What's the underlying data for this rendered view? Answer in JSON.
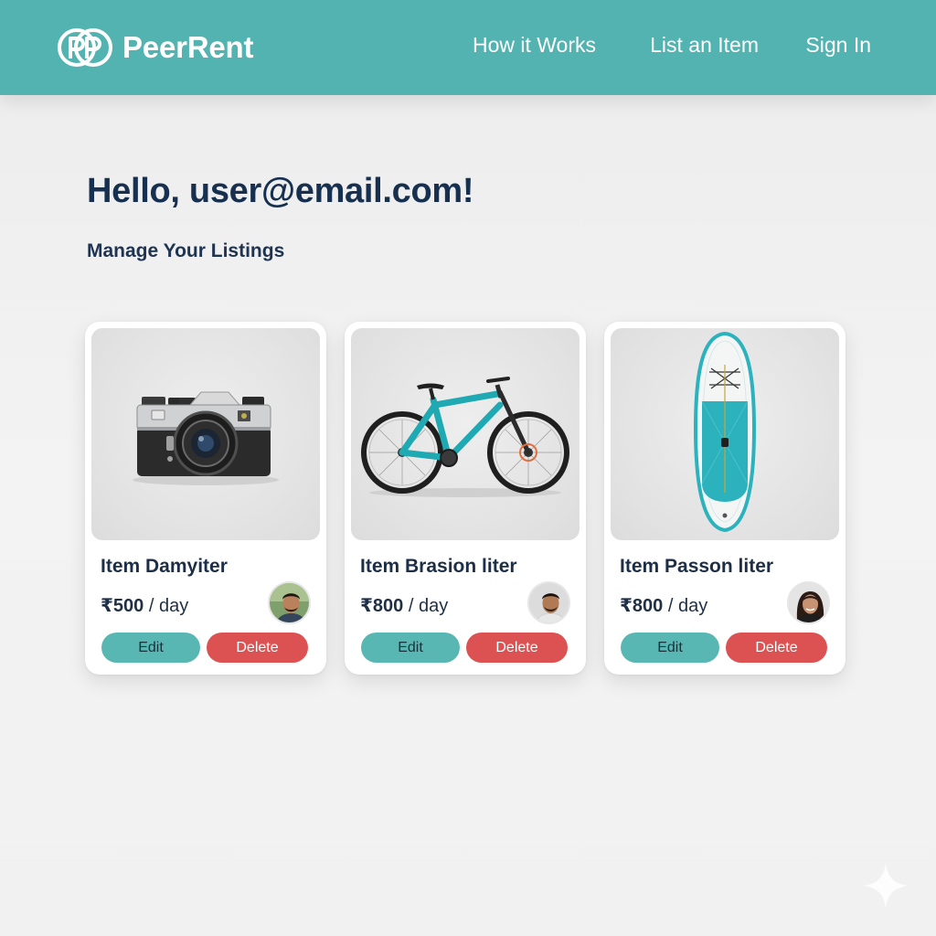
{
  "header": {
    "brand_name": "PeerRent",
    "logo_icon": "pp-monogram-icon",
    "nav": [
      "How it Works",
      "List an Item",
      "Sign In"
    ]
  },
  "main": {
    "greeting": "Hello, user@email.com!",
    "subheading": "Manage Your Listings"
  },
  "listings": [
    {
      "title": "Item Damyiter",
      "price": "₹500",
      "unit": "/ day",
      "image": "film-camera",
      "edit": "Edit",
      "delete": "Delete"
    },
    {
      "title": "Item Brasion liter",
      "price": "₹800",
      "unit": "/ day",
      "image": "teal-mountain-bike",
      "edit": "Edit",
      "delete": "Delete"
    },
    {
      "title": "Item Passon liter",
      "price": "₹800",
      "unit": "/ day",
      "image": "paddle-board",
      "edit": "Edit",
      "delete": "Delete"
    }
  ],
  "colors": {
    "header": "#53b3b1",
    "edit_button": "#58b7b3",
    "delete_button": "#dc5252",
    "heading_text": "#17304f"
  }
}
